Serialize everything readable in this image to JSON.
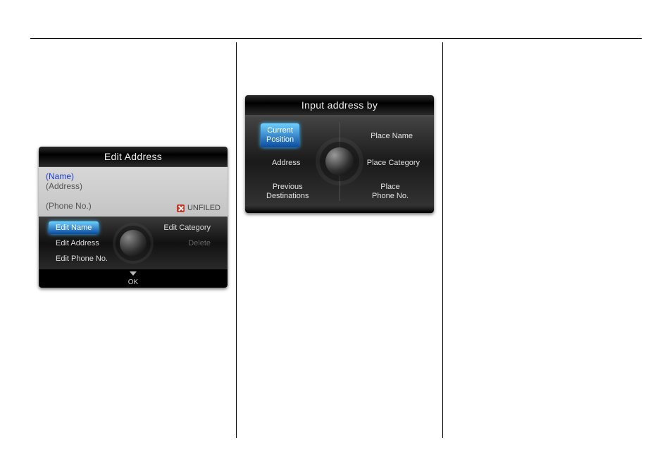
{
  "screen1": {
    "title": "Edit Address",
    "name": "(Name)",
    "address": "(Address)",
    "phone": "(Phone No.)",
    "unfiled": "UNFILED",
    "opts": {
      "edit_name": "Edit Name",
      "edit_address": "Edit Address",
      "edit_phone": "Edit Phone No.",
      "edit_category": "Edit Category",
      "delete": "Delete"
    },
    "ok": "OK"
  },
  "screen2": {
    "title": "Input address by",
    "opts": {
      "current_l1": "Current",
      "current_l2": "Position",
      "address": "Address",
      "prev_l1": "Previous",
      "prev_l2": "Destinations",
      "place_name": "Place Name",
      "place_category": "Place Category",
      "phone_l1": "Place",
      "phone_l2": "Phone No."
    }
  }
}
